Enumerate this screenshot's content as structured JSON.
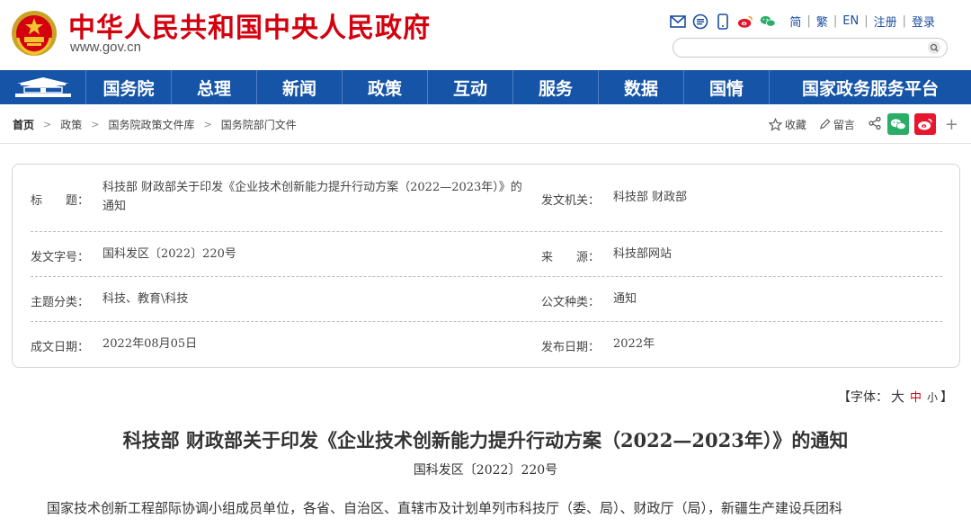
{
  "header": {
    "site_title": "中华人民共和国中央人民政府",
    "site_url": "www.gov.cn",
    "lang_links": [
      "简",
      "繁",
      "EN",
      "注册",
      "登录"
    ],
    "search_placeholder": ""
  },
  "nav": {
    "items": [
      "国务院",
      "总理",
      "新闻",
      "政策",
      "互动",
      "服务",
      "数据",
      "国情",
      "国家政务服务平台"
    ]
  },
  "breadcrumb": [
    "首页",
    "政策",
    "国务院政策文件库",
    "国务院部门文件"
  ],
  "actions": {
    "favorite": "收藏",
    "comment": "留言"
  },
  "info": {
    "title_label": "标　　题：",
    "title_value": "科技部 财政部关于印发《企业技术创新能力提升行动方案（2022—2023年）》的通知",
    "issuer_label": "发文机关：",
    "issuer_value": "科技部 财政部",
    "docno_label": "发文字号：",
    "docno_value": "国科发区〔2022〕220号",
    "source_label": "来　　源：",
    "source_value": "科技部网站",
    "topic_label": "主题分类：",
    "topic_value": "科技、教育\\科技",
    "type_label": "公文种类：",
    "type_value": "通知",
    "created_label": "成文日期：",
    "created_value": "2022年08月05日",
    "published_label": "发布日期：",
    "published_value": "2022年"
  },
  "font_size": {
    "prefix": "【字体：",
    "big": "大",
    "mid": "中",
    "small": "小",
    "suffix": "】"
  },
  "article": {
    "title": "科技部 财政部关于印发《企业技术创新能力提升行动方案（2022—2023年）》的通知",
    "doc_no": "国科发区〔2022〕220号",
    "body_first_line": "国家技术创新工程部际协调小组成员单位，各省、自治区、直辖市及计划单列市科技厅（委、局）、财政厅（局），新疆生产建设兵团科"
  },
  "colors": {
    "brand_red": "#d4000e",
    "nav_blue": "#1554a7",
    "link_blue": "#1a4e9e",
    "wechat_green": "#2aae67",
    "weibo_red": "#e6162d"
  }
}
